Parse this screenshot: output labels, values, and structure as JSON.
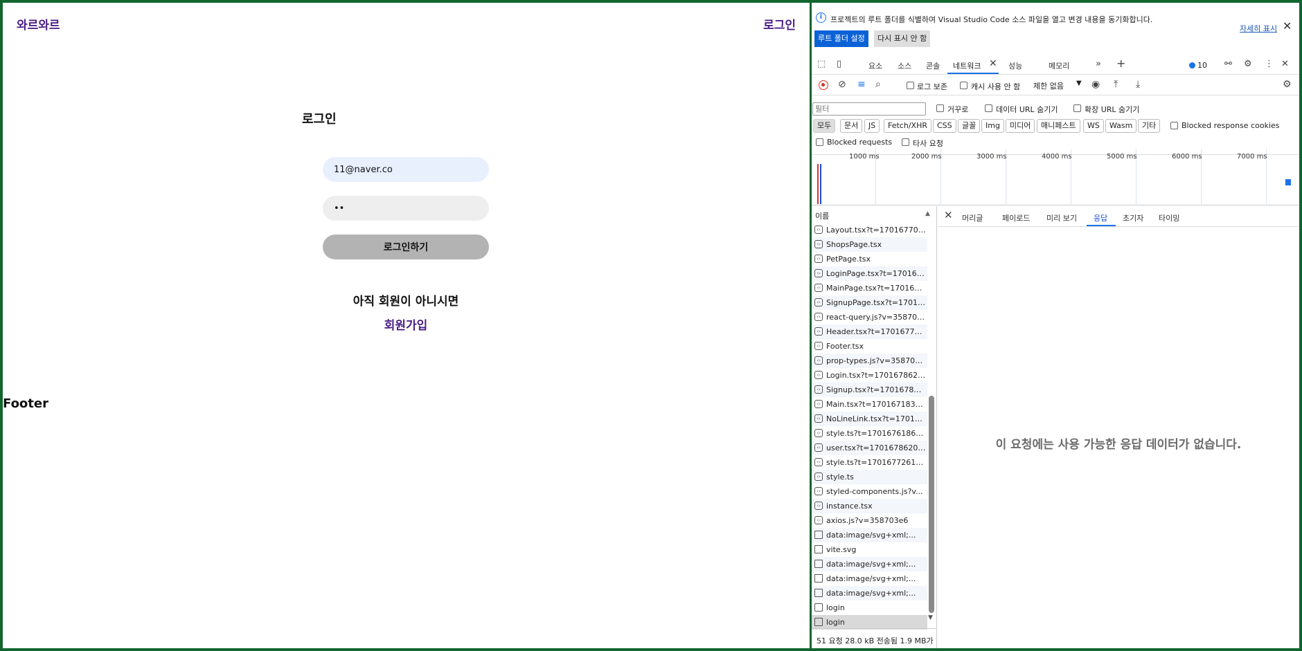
{
  "app": {
    "logo": "와르와르",
    "header_login": "로그인",
    "page_title": "로그인",
    "email_value": "11@naver.co",
    "password_mask": "••",
    "submit_label": "로그인하기",
    "not_member_text": "아직 회원이 아니시면",
    "signup_link": "회원가입",
    "footer": "Footer"
  },
  "devtools": {
    "banner": {
      "message": "프로젝트의 루트 폴더를 식별하여 Visual Studio Code 소스 파일을 열고 변경 내용을 동기화합니다.",
      "primary_button": "루트 폴더 설정",
      "secondary_button": "다시 표시 안 함",
      "more_link": "자세히 표시",
      "info_icon": "i"
    },
    "tabs": [
      "요소",
      "소스",
      "콘솔",
      "네트워크",
      "성능",
      "메모리"
    ],
    "issues_count": "10",
    "toolbar": {
      "preserve_log": "로그 보존",
      "disable_cache": "캐시 사용 안 함",
      "throttling": "제한 없음"
    },
    "filter": {
      "placeholder": "필터",
      "invert": "거꾸로",
      "hide_data_urls": "데이터 URL 숨기기",
      "hide_extension_urls": "확장 URL 숨기기",
      "types": [
        "모두",
        "문서",
        "JS",
        "Fetch/XHR",
        "CSS",
        "글꼴",
        "Img",
        "미디어",
        "매니페스트",
        "WS",
        "Wasm",
        "기타"
      ],
      "blocked_cookies": "Blocked response cookies",
      "blocked_requests": "Blocked requests",
      "third_party": "타사 요청"
    },
    "timeline_ticks": [
      "1000 ms",
      "2000 ms",
      "3000 ms",
      "4000 ms",
      "5000 ms",
      "6000 ms",
      "7000 ms"
    ],
    "list_header": "이름",
    "requests": [
      {
        "name": "Layout.tsx?t=170167708...",
        "type": "script"
      },
      {
        "name": "ShopsPage.tsx",
        "type": "script"
      },
      {
        "name": "PetPage.tsx",
        "type": "script"
      },
      {
        "name": "LoginPage.tsx?t=170167...",
        "type": "script"
      },
      {
        "name": "MainPage.tsx?t=170167...",
        "type": "script"
      },
      {
        "name": "SignupPage.tsx?t=17016...",
        "type": "script"
      },
      {
        "name": "react-query.js?v=358703...",
        "type": "script"
      },
      {
        "name": "Header.tsx?t=17016770...",
        "type": "script"
      },
      {
        "name": "Footer.tsx",
        "type": "script"
      },
      {
        "name": "prop-types.js?v=358703e6",
        "type": "script"
      },
      {
        "name": "Login.tsx?t=1701678620...",
        "type": "script"
      },
      {
        "name": "Signup.tsx?t=170167862...",
        "type": "script"
      },
      {
        "name": "Main.tsx?t=1701671832...",
        "type": "script"
      },
      {
        "name": "NoLineLink.tsx?t=17016...",
        "type": "script"
      },
      {
        "name": "style.ts?t=1701676186087",
        "type": "script"
      },
      {
        "name": "user.tsx?t=17016786202...",
        "type": "script"
      },
      {
        "name": "style.ts?t=1701677261263",
        "type": "script"
      },
      {
        "name": "style.ts",
        "type": "script"
      },
      {
        "name": "styled-components.js?v...",
        "type": "script"
      },
      {
        "name": "instance.tsx",
        "type": "script"
      },
      {
        "name": "axios.js?v=358703e6",
        "type": "script"
      },
      {
        "name": "data:image/svg+xml;...",
        "type": "doc"
      },
      {
        "name": "vite.svg",
        "type": "doc"
      },
      {
        "name": "data:image/svg+xml;...",
        "type": "doc"
      },
      {
        "name": "data:image/svg+xml;...",
        "type": "doc"
      },
      {
        "name": "data:image/svg+xml;...",
        "type": "doc"
      },
      {
        "name": "login",
        "type": "fetch"
      },
      {
        "name": "login",
        "type": "doc"
      }
    ],
    "status": "51 요청  28.0 kB 전송됨  1.9 MB가",
    "detail_tabs": [
      "머리글",
      "페이로드",
      "미리 보기",
      "응답",
      "초기자",
      "타이밍"
    ],
    "empty_message": "이 요청에는 사용 가능한 응답 데이터가 없습니다."
  }
}
